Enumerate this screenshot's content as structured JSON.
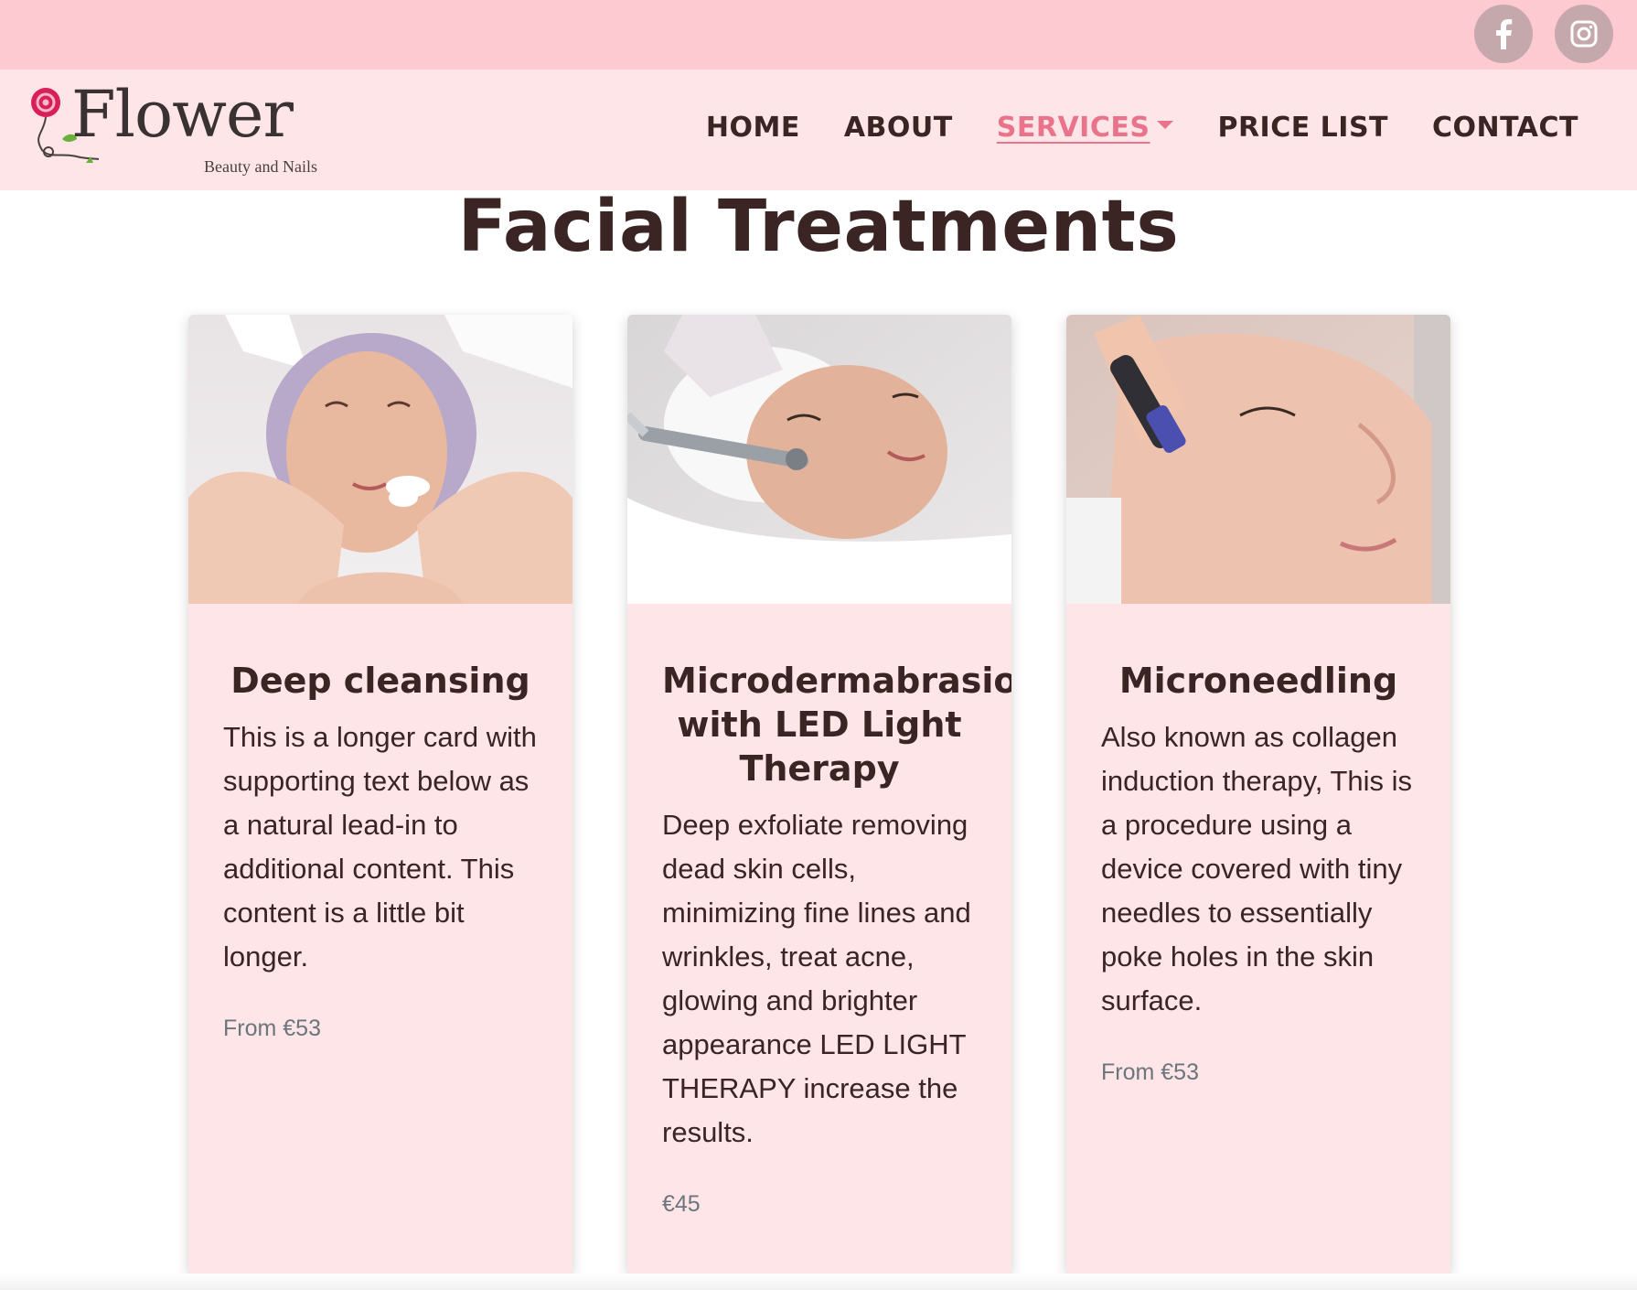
{
  "social": {
    "facebook_icon": "facebook-f",
    "instagram_icon": "instagram"
  },
  "brand": {
    "name": "Flower",
    "tagline": "Beauty and Nails"
  },
  "nav": {
    "items": [
      {
        "label": "HOME",
        "active": false
      },
      {
        "label": "ABOUT",
        "active": false
      },
      {
        "label": "SERVICES",
        "active": true,
        "dropdown": true
      },
      {
        "label": "PRICE LIST",
        "active": false
      },
      {
        "label": "CONTACT",
        "active": false
      }
    ]
  },
  "page": {
    "title": "Facial Treatments"
  },
  "cards": [
    {
      "title": "Deep cleansing",
      "text": "This is a longer card with supporting text below as a natural lead-in to additional content. This content is a little bit longer.",
      "price": "From €53"
    },
    {
      "title": "Microdermabrasion with LED Light Therapy",
      "text": "Deep exfoliate removing dead skin cells, minimizing fine lines and wrinkles, treat acne, glowing and brighter appearance LED LIGHT THERAPY increase the results.",
      "price": "€45"
    },
    {
      "title": "Microneedling",
      "text": "Also known as collagen induction therapy, This is a procedure using a device covered with tiny needles to essentially poke holes in the skin surface.",
      "price": "From €53"
    }
  ],
  "colors": {
    "topbar": "#fccad0",
    "header": "#fee5e8",
    "card": "#fee5e8",
    "accent": "#e8738a",
    "text": "#3a2424",
    "social_circle": "#c4a8ab"
  }
}
